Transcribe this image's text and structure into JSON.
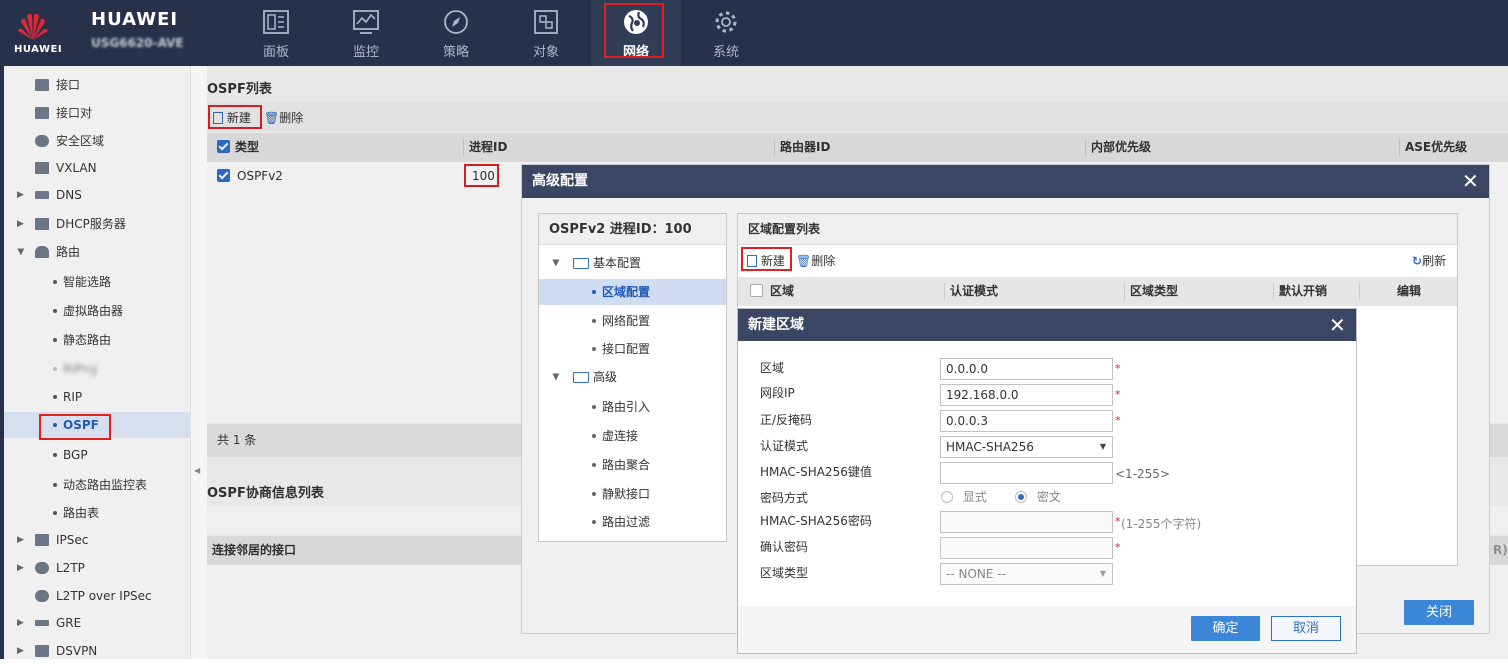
{
  "header": {
    "brand": "HUAWEI",
    "model": "USG6620-AVE",
    "logo_text": "HUAWEI",
    "nav": [
      {
        "label": "面板",
        "icon": "dashboard-icon"
      },
      {
        "label": "监控",
        "icon": "monitor-icon"
      },
      {
        "label": "策略",
        "icon": "policy-compass-icon"
      },
      {
        "label": "对象",
        "icon": "object-icon"
      },
      {
        "label": "网络",
        "icon": "network-globe-icon"
      },
      {
        "label": "系统",
        "icon": "gear-icon"
      }
    ],
    "active_nav": "网络"
  },
  "sidebar": {
    "items": [
      {
        "label": "接口"
      },
      {
        "label": "接口对"
      },
      {
        "label": "安全区域"
      },
      {
        "label": "VXLAN"
      },
      {
        "label": "DNS"
      },
      {
        "label": "DHCP服务器"
      },
      {
        "label": "路由"
      },
      {
        "label": "智能选路"
      },
      {
        "label": "虚拟路由器"
      },
      {
        "label": "静态路由"
      },
      {
        "label": "RIPng"
      },
      {
        "label": "RIP"
      },
      {
        "label": "OSPF"
      },
      {
        "label": "BGP"
      },
      {
        "label": "动态路由监控表"
      },
      {
        "label": "路由表"
      },
      {
        "label": "IPSec"
      },
      {
        "label": "L2TP"
      },
      {
        "label": "L2TP over IPSec"
      },
      {
        "label": "GRE"
      },
      {
        "label": "DSVPN"
      }
    ]
  },
  "ospf_list": {
    "title": "OSPF列表",
    "new_label": "新建",
    "delete_label": "删除",
    "columns": [
      "类型",
      "进程ID",
      "路由器ID",
      "内部优先级",
      "ASE优先级"
    ],
    "rows": [
      {
        "type": "OSPFv2",
        "process_id": "100"
      }
    ],
    "total": "共 1 条"
  },
  "neighbor_list": {
    "title": "OSPF协商信息列表",
    "column_first": "连接邻居的接口",
    "column_last_fragment": "R)"
  },
  "advanced_dialog": {
    "title": "高级配置",
    "tree_title": "OSPFv2 进程ID：100",
    "tree": [
      {
        "label": "基本配置",
        "type": "folder"
      },
      {
        "label": "区域配置",
        "type": "leaf"
      },
      {
        "label": "网络配置",
        "type": "leaf"
      },
      {
        "label": "接口配置",
        "type": "leaf"
      },
      {
        "label": "高级",
        "type": "folder"
      },
      {
        "label": "路由引入",
        "type": "leaf"
      },
      {
        "label": "虚连接",
        "type": "leaf"
      },
      {
        "label": "路由聚合",
        "type": "leaf"
      },
      {
        "label": "静默接口",
        "type": "leaf"
      },
      {
        "label": "路由过滤",
        "type": "leaf"
      }
    ],
    "area_list": {
      "title": "区域配置列表",
      "new_label": "新建",
      "delete_label": "删除",
      "refresh_label": "刷新",
      "columns": [
        "区域",
        "认证模式",
        "区域类型",
        "默认开销",
        "编辑"
      ]
    },
    "close_label": "关闭"
  },
  "new_area_dialog": {
    "title": "新建区域",
    "fields": {
      "area": {
        "label": "区域",
        "value": "0.0.0.0"
      },
      "network_ip": {
        "label": "网段IP",
        "value": "192.168.0.0"
      },
      "mask": {
        "label": "正/反掩码",
        "value": "0.0.0.3"
      },
      "auth_mode": {
        "label": "认证模式",
        "value": "HMAC-SHA256"
      },
      "key_id": {
        "label": "HMAC-SHA256键值",
        "value": "",
        "hint": "<1-255>"
      },
      "password_mode": {
        "label": "密码方式",
        "options": [
          "显式",
          "密文"
        ],
        "selected": "密文"
      },
      "password": {
        "label": "HMAC-SHA256密码",
        "value": "",
        "hint": "(1-255个字符)"
      },
      "confirm_password": {
        "label": "确认密码",
        "value": ""
      },
      "area_type": {
        "label": "区域类型",
        "value": "-- NONE --"
      }
    },
    "ok_label": "确定",
    "cancel_label": "取消"
  }
}
